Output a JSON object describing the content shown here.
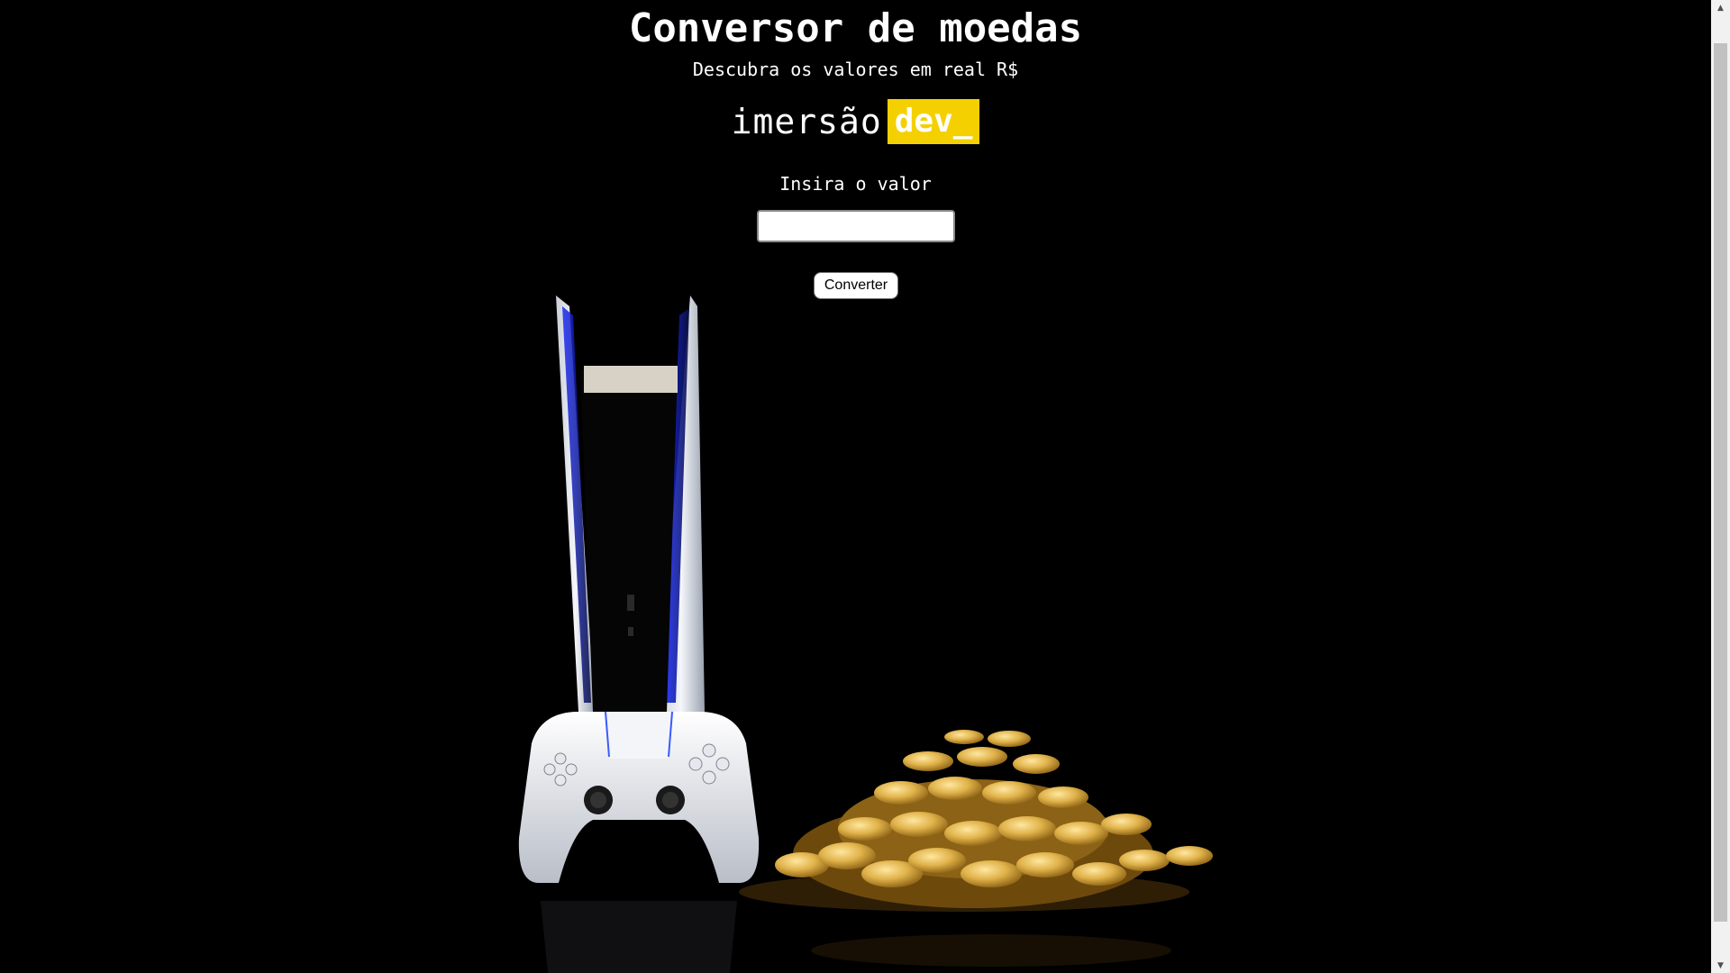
{
  "page": {
    "title": "Conversor de moedas",
    "subtitle": "Descubra os valores em real R$"
  },
  "logo": {
    "text": "imersão",
    "badge": "dev_",
    "badge_color": "#f5d000"
  },
  "form": {
    "label": "Insira o valor",
    "input_value": "",
    "button_label": "Converter"
  },
  "scrollbar": {
    "up_icon": "▲",
    "down_icon": "▼"
  }
}
